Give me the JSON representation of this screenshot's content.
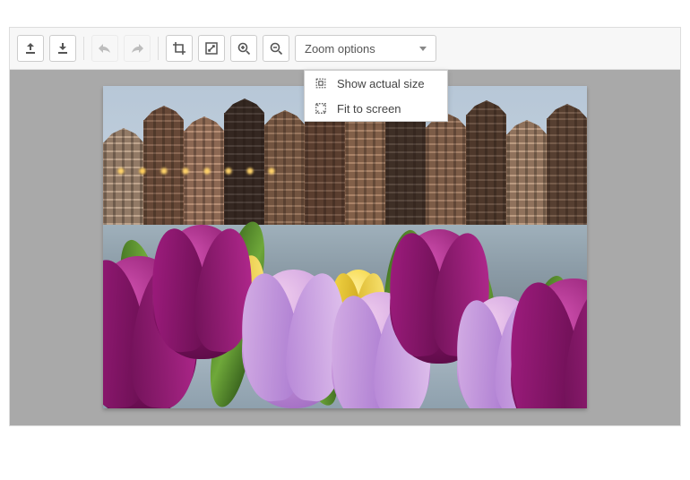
{
  "toolbar": {
    "upload_icon": "upload-icon",
    "download_icon": "download-icon",
    "undo_icon": "undo-icon",
    "redo_icon": "redo-icon",
    "crop_icon": "crop-icon",
    "resize_icon": "resize-icon",
    "zoom_in_icon": "zoom-in-icon",
    "zoom_out_icon": "zoom-out-icon",
    "zoom_dropdown_label": "Zoom options"
  },
  "zoom_menu": {
    "items": [
      {
        "icon": "actual-size-icon",
        "label": "Show actual size"
      },
      {
        "icon": "fit-screen-icon",
        "label": "Fit to screen"
      }
    ]
  }
}
